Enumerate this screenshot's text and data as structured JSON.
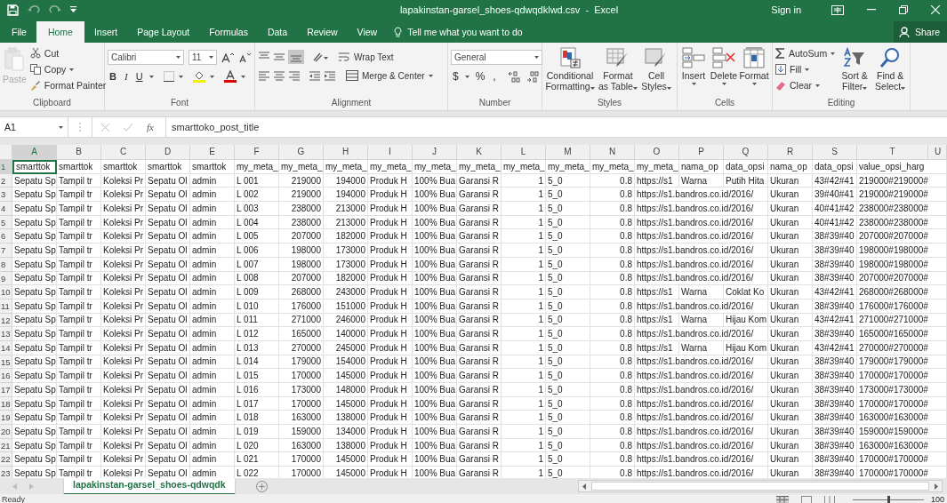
{
  "title_bar": {
    "title": "lapakinstan-garsel_shoes-qdwqdklwd.csv  -  Excel",
    "sign_in": "Sign in"
  },
  "menu_tabs": [
    {
      "label": "File",
      "selected": false
    },
    {
      "label": "Home",
      "selected": true
    },
    {
      "label": "Insert",
      "selected": false
    },
    {
      "label": "Page Layout",
      "selected": false
    },
    {
      "label": "Formulas",
      "selected": false
    },
    {
      "label": "Data",
      "selected": false
    },
    {
      "label": "Review",
      "selected": false
    },
    {
      "label": "View",
      "selected": false
    }
  ],
  "tell_me": "Tell me what you want to do",
  "share": "Share",
  "ribbon": {
    "clipboard": {
      "paste": {
        "label": "Paste",
        "disabled": true
      },
      "cut": "Cut",
      "copy": "Copy",
      "format_painter": "Format Painter",
      "label": "Clipboard"
    },
    "font": {
      "font_name": "Calibri",
      "font_size": "11",
      "bold": "B",
      "italic": "I",
      "underline": "U",
      "label": "Font"
    },
    "alignment": {
      "wrap_text": "Wrap Text",
      "merge_center": "Merge & Center",
      "label": "Alignment"
    },
    "number": {
      "format": "General",
      "currency": "$",
      "percent": "%",
      "comma": ",",
      "label": "Number"
    },
    "styles": {
      "conditional_formatting": "Conditional Formatting",
      "format_as_table": "Format as Table",
      "cell_styles": "Cell Styles",
      "label": "Styles"
    },
    "cells": {
      "insert": "Insert",
      "delete": "Delete",
      "format": "Format",
      "label": "Cells"
    },
    "editing": {
      "autosum": "AutoSum",
      "fill": "Fill",
      "clear": "Clear",
      "sort_filter": "Sort & Filter",
      "find_select": "Find & Select",
      "label": "Editing"
    }
  },
  "formula_bar": {
    "name_box": "A1",
    "fx": "fx",
    "formula": "smarttoko_post_title"
  },
  "sheet": {
    "columns": [
      {
        "letter": "A",
        "selected": true
      },
      {
        "letter": "B",
        "selected": false
      },
      {
        "letter": "C",
        "selected": false
      },
      {
        "letter": "D",
        "selected": false
      },
      {
        "letter": "E",
        "selected": false
      },
      {
        "letter": "F",
        "selected": false
      },
      {
        "letter": "G",
        "selected": false
      },
      {
        "letter": "H",
        "selected": false
      },
      {
        "letter": "I",
        "selected": false
      },
      {
        "letter": "J",
        "selected": false
      },
      {
        "letter": "K",
        "selected": false
      },
      {
        "letter": "L",
        "selected": false
      },
      {
        "letter": "M",
        "selected": false
      },
      {
        "letter": "N",
        "selected": false
      },
      {
        "letter": "O",
        "selected": false
      },
      {
        "letter": "P",
        "selected": false
      },
      {
        "letter": "Q",
        "selected": false
      },
      {
        "letter": "R",
        "selected": false
      },
      {
        "letter": "S",
        "selected": false
      },
      {
        "letter": "T",
        "selected": false
      },
      {
        "letter": "U",
        "selected": false
      }
    ],
    "rows": [
      {
        "number": "1",
        "selected": true,
        "cells": {
          "A": "smarttok",
          "B": "smarttok",
          "C": "smarttok",
          "D": "smarttok",
          "E": "smarttok",
          "F": "my_meta_",
          "G": "my_meta_",
          "H": "my_meta_",
          "I": "my_meta_",
          "J": "my_meta_",
          "K": "my_meta_",
          "L": "my_meta_",
          "M": "my_meta_",
          "N": "my_meta_",
          "O": "my_meta_",
          "P": "nama_op",
          "Q": "data_opsi",
          "R": "nama_op",
          "S": "data_opsi",
          "T": "value_opsi_harg"
        }
      },
      {
        "number": "2",
        "selected": false,
        "cells": {
          "A": "Sepatu Sp",
          "B": "Tampil tr",
          "C": "Koleksi Pr",
          "D": "Sepatu Ol",
          "E": "admin",
          "F": "L 001",
          "G": "219000",
          "H": "194000",
          "I": "Produk H",
          "J": "100% Bua",
          "K": "Garansi R",
          "L": "1",
          "M": "5_0",
          "N": "0.8",
          "O": "https://s1",
          "P": "Warna",
          "Q": "Putih Hita",
          "R": "Ukuran",
          "S": "43#42#41",
          "T": "219000#219000#"
        }
      },
      {
        "number": "3",
        "selected": false,
        "cells": {
          "A": "Sepatu Sp",
          "B": "Tampil tr",
          "C": "Koleksi Pr",
          "D": "Sepatu Ol",
          "E": "admin",
          "F": "L 002",
          "G": "219000",
          "H": "194000",
          "I": "Produk H",
          "J": "100% Bua",
          "K": "Garansi R",
          "L": "1",
          "M": "5_0",
          "N": "0.8",
          "O": "https://s1.bandros.co.id/2016/",
          "R": "Ukuran",
          "S": "39#40#41",
          "T": "219000#219000#"
        }
      },
      {
        "number": "4",
        "selected": false,
        "cells": {
          "A": "Sepatu Sp",
          "B": "Tampil tr",
          "C": "Koleksi Pr",
          "D": "Sepatu Ol",
          "E": "admin",
          "F": "L 003",
          "G": "238000",
          "H": "213000",
          "I": "Produk H",
          "J": "100% Bua",
          "K": "Garansi R",
          "L": "1",
          "M": "5_0",
          "N": "0.8",
          "O": "https://s1.bandros.co.id/2016/",
          "R": "Ukuran",
          "S": "40#41#42",
          "T": "238000#238000#"
        }
      },
      {
        "number": "5",
        "selected": false,
        "cells": {
          "A": "Sepatu Sp",
          "B": "Tampil tr",
          "C": "Koleksi Pr",
          "D": "Sepatu Ol",
          "E": "admin",
          "F": "L 004",
          "G": "238000",
          "H": "213000",
          "I": "Produk H",
          "J": "100% Bua",
          "K": "Garansi R",
          "L": "1",
          "M": "5_0",
          "N": "0.8",
          "O": "https://s1.bandros.co.id/2016/",
          "R": "Ukuran",
          "S": "40#41#42",
          "T": "238000#238000#"
        }
      },
      {
        "number": "6",
        "selected": false,
        "cells": {
          "A": "Sepatu Sp",
          "B": "Tampil tr",
          "C": "Koleksi Pr",
          "D": "Sepatu Ol",
          "E": "admin",
          "F": "L 005",
          "G": "207000",
          "H": "182000",
          "I": "Produk H",
          "J": "100% Bua",
          "K": "Garansi R",
          "L": "1",
          "M": "5_0",
          "N": "0.8",
          "O": "https://s1.bandros.co.id/2016/",
          "R": "Ukuran",
          "S": "38#39#40",
          "T": "207000#207000#"
        }
      },
      {
        "number": "7",
        "selected": false,
        "cells": {
          "A": "Sepatu Sp",
          "B": "Tampil tr",
          "C": "Koleksi Pr",
          "D": "Sepatu Ol",
          "E": "admin",
          "F": "L 006",
          "G": "198000",
          "H": "173000",
          "I": "Produk H",
          "J": "100% Bua",
          "K": "Garansi R",
          "L": "1",
          "M": "5_0",
          "N": "0.8",
          "O": "https://s1.bandros.co.id/2016/",
          "R": "Ukuran",
          "S": "38#39#40",
          "T": "198000#198000#"
        }
      },
      {
        "number": "8",
        "selected": false,
        "cells": {
          "A": "Sepatu Sp",
          "B": "Tampil tr",
          "C": "Koleksi Pr",
          "D": "Sepatu Ol",
          "E": "admin",
          "F": "L 007",
          "G": "198000",
          "H": "173000",
          "I": "Produk H",
          "J": "100% Bua",
          "K": "Garansi R",
          "L": "1",
          "M": "5_0",
          "N": "0.8",
          "O": "https://s1.bandros.co.id/2016/",
          "R": "Ukuran",
          "S": "38#39#40",
          "T": "198000#198000#"
        }
      },
      {
        "number": "9",
        "selected": false,
        "cells": {
          "A": "Sepatu Sp",
          "B": "Tampil tr",
          "C": "Koleksi Pr",
          "D": "Sepatu Ol",
          "E": "admin",
          "F": "L 008",
          "G": "207000",
          "H": "182000",
          "I": "Produk H",
          "J": "100% Bua",
          "K": "Garansi R",
          "L": "1",
          "M": "5_0",
          "N": "0.8",
          "O": "https://s1.bandros.co.id/2016/",
          "R": "Ukuran",
          "S": "38#39#40",
          "T": "207000#207000#"
        }
      },
      {
        "number": "10",
        "selected": false,
        "cells": {
          "A": "Sepatu Sp",
          "B": "Tampil tr",
          "C": "Koleksi Pr",
          "D": "Sepatu Ol",
          "E": "admin",
          "F": "L 009",
          "G": "268000",
          "H": "243000",
          "I": "Produk H",
          "J": "100% Bua",
          "K": "Garansi R",
          "L": "1",
          "M": "5_0",
          "N": "0.8",
          "O": "https://s1",
          "P": "Warna",
          "Q": "Coklat Ko",
          "R": "Ukuran",
          "S": "43#42#41",
          "T": "268000#268000#"
        }
      },
      {
        "number": "11",
        "selected": false,
        "cells": {
          "A": "Sepatu Sp",
          "B": "Tampil tr",
          "C": "Koleksi Pr",
          "D": "Sepatu Ol",
          "E": "admin",
          "F": "L 010",
          "G": "176000",
          "H": "151000",
          "I": "Produk H",
          "J": "100% Bua",
          "K": "Garansi R",
          "L": "1",
          "M": "5_0",
          "N": "0.8",
          "O": "https://s1.bandros.co.id/2016/",
          "R": "Ukuran",
          "S": "38#39#40",
          "T": "176000#176000#"
        }
      },
      {
        "number": "12",
        "selected": false,
        "cells": {
          "A": "Sepatu Sp",
          "B": "Tampil tr",
          "C": "Koleksi Pr",
          "D": "Sepatu Ol",
          "E": "admin",
          "F": "L 011",
          "G": "271000",
          "H": "246000",
          "I": "Produk H",
          "J": "100% Bua",
          "K": "Garansi R",
          "L": "1",
          "M": "5_0",
          "N": "0.8",
          "O": "https://s1",
          "P": "Warna",
          "Q": "Hijau Kom",
          "R": "Ukuran",
          "S": "43#42#41",
          "T": "271000#271000#"
        }
      },
      {
        "number": "13",
        "selected": false,
        "cells": {
          "A": "Sepatu Sp",
          "B": "Tampil tr",
          "C": "Koleksi Pr",
          "D": "Sepatu Ol",
          "E": "admin",
          "F": "L 012",
          "G": "165000",
          "H": "140000",
          "I": "Produk H",
          "J": "100% Bua",
          "K": "Garansi R",
          "L": "1",
          "M": "5_0",
          "N": "0.8",
          "O": "https://s1.bandros.co.id/2016/",
          "R": "Ukuran",
          "S": "38#39#40",
          "T": "165000#165000#"
        }
      },
      {
        "number": "14",
        "selected": false,
        "cells": {
          "A": "Sepatu Sp",
          "B": "Tampil tr",
          "C": "Koleksi Pr",
          "D": "Sepatu Ol",
          "E": "admin",
          "F": "L 013",
          "G": "270000",
          "H": "245000",
          "I": "Produk H",
          "J": "100% Bua",
          "K": "Garansi R",
          "L": "1",
          "M": "5_0",
          "N": "0.8",
          "O": "https://s1",
          "P": "Warna",
          "Q": "Hijau Kom",
          "R": "Ukuran",
          "S": "43#42#41",
          "T": "270000#270000#"
        }
      },
      {
        "number": "15",
        "selected": false,
        "cells": {
          "A": "Sepatu Sp",
          "B": "Tampil tr",
          "C": "Koleksi Pr",
          "D": "Sepatu Ol",
          "E": "admin",
          "F": "L 014",
          "G": "179000",
          "H": "154000",
          "I": "Produk H",
          "J": "100% Bua",
          "K": "Garansi R",
          "L": "1",
          "M": "5_0",
          "N": "0.8",
          "O": "https://s1.bandros.co.id/2016/",
          "R": "Ukuran",
          "S": "38#39#40",
          "T": "179000#179000#"
        }
      },
      {
        "number": "16",
        "selected": false,
        "cells": {
          "A": "Sepatu Sp",
          "B": "Tampil tr",
          "C": "Koleksi Pr",
          "D": "Sepatu Ol",
          "E": "admin",
          "F": "L 015",
          "G": "170000",
          "H": "145000",
          "I": "Produk H",
          "J": "100% Bua",
          "K": "Garansi R",
          "L": "1",
          "M": "5_0",
          "N": "0.8",
          "O": "https://s1.bandros.co.id/2016/",
          "R": "Ukuran",
          "S": "38#39#40",
          "T": "170000#170000#"
        }
      },
      {
        "number": "17",
        "selected": false,
        "cells": {
          "A": "Sepatu Sp",
          "B": "Tampil tr",
          "C": "Koleksi Pr",
          "D": "Sepatu Ol",
          "E": "admin",
          "F": "L 016",
          "G": "173000",
          "H": "148000",
          "I": "Produk H",
          "J": "100% Bua",
          "K": "Garansi R",
          "L": "1",
          "M": "5_0",
          "N": "0.8",
          "O": "https://s1.bandros.co.id/2016/",
          "R": "Ukuran",
          "S": "38#39#40",
          "T": "173000#173000#"
        }
      },
      {
        "number": "18",
        "selected": false,
        "cells": {
          "A": "Sepatu Sp",
          "B": "Tampil tr",
          "C": "Koleksi Pr",
          "D": "Sepatu Ol",
          "E": "admin",
          "F": "L 017",
          "G": "170000",
          "H": "145000",
          "I": "Produk H",
          "J": "100% Bua",
          "K": "Garansi R",
          "L": "1",
          "M": "5_0",
          "N": "0.8",
          "O": "https://s1.bandros.co.id/2016/",
          "R": "Ukuran",
          "S": "38#39#40",
          "T": "170000#170000#"
        }
      },
      {
        "number": "19",
        "selected": false,
        "cells": {
          "A": "Sepatu Sp",
          "B": "Tampil tr",
          "C": "Koleksi Pr",
          "D": "Sepatu Ol",
          "E": "admin",
          "F": "L 018",
          "G": "163000",
          "H": "138000",
          "I": "Produk H",
          "J": "100% Bua",
          "K": "Garansi R",
          "L": "1",
          "M": "5_0",
          "N": "0.8",
          "O": "https://s1.bandros.co.id/2016/",
          "R": "Ukuran",
          "S": "38#39#40",
          "T": "163000#163000#"
        }
      },
      {
        "number": "20",
        "selected": false,
        "cells": {
          "A": "Sepatu Sp",
          "B": "Tampil tr",
          "C": "Koleksi Pr",
          "D": "Sepatu Ol",
          "E": "admin",
          "F": "L 019",
          "G": "159000",
          "H": "134000",
          "I": "Produk H",
          "J": "100% Bua",
          "K": "Garansi R",
          "L": "1",
          "M": "5_0",
          "N": "0.8",
          "O": "https://s1.bandros.co.id/2016/",
          "R": "Ukuran",
          "S": "38#39#40",
          "T": "159000#159000#"
        }
      },
      {
        "number": "21",
        "selected": false,
        "cells": {
          "A": "Sepatu Sp",
          "B": "Tampil tr",
          "C": "Koleksi Pr",
          "D": "Sepatu Ol",
          "E": "admin",
          "F": "L 020",
          "G": "163000",
          "H": "138000",
          "I": "Produk H",
          "J": "100% Bua",
          "K": "Garansi R",
          "L": "1",
          "M": "5_0",
          "N": "0.8",
          "O": "https://s1.bandros.co.id/2016/",
          "R": "Ukuran",
          "S": "38#39#40",
          "T": "163000#163000#"
        }
      },
      {
        "number": "22",
        "selected": false,
        "cells": {
          "A": "Sepatu Sp",
          "B": "Tampil tr",
          "C": "Koleksi Pr",
          "D": "Sepatu Ol",
          "E": "admin",
          "F": "L 021",
          "G": "170000",
          "H": "145000",
          "I": "Produk H",
          "J": "100% Bua",
          "K": "Garansi R",
          "L": "1",
          "M": "5_0",
          "N": "0.8",
          "O": "https://s1.bandros.co.id/2016/",
          "R": "Ukuran",
          "S": "38#39#40",
          "T": "170000#170000#"
        }
      },
      {
        "number": "23",
        "selected": false,
        "cells": {
          "A": "Sepatu Sp",
          "B": "Tampil tr",
          "C": "Koleksi Pr",
          "D": "Sepatu Ol",
          "E": "admin",
          "F": "L 022",
          "G": "170000",
          "H": "145000",
          "I": "Produk H",
          "J": "100% Bua",
          "K": "Garansi R",
          "L": "1",
          "M": "5_0",
          "N": "0.8",
          "O": "https://s1.bandros.co.id/2016/",
          "R": "Ukuran",
          "S": "38#39#40",
          "T": "170000#170000#"
        }
      }
    ]
  },
  "sheet_tabs": [
    {
      "label": "lapakinstan-garsel_shoes-qdwqdk",
      "selected": true
    }
  ],
  "status_bar": {
    "text": "Ready",
    "zoom_slider": {
      "level": 0.5
    },
    "zoom": "100"
  }
}
